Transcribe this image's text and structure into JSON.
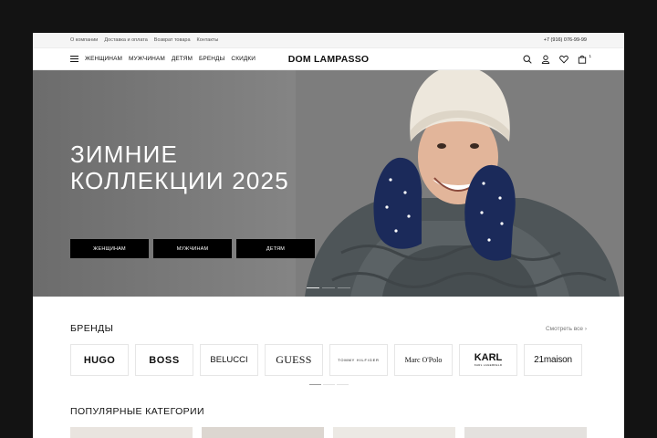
{
  "topbar": {
    "links": [
      "О компании",
      "Доставка и оплата",
      "Возврат товара",
      "Контакты"
    ],
    "phone": "+7 (916) 076-99-99"
  },
  "header": {
    "nav": [
      "ЖЕНЩИНАМ",
      "МУЖЧИНАМ",
      "ДЕТЯМ",
      "БРЕНДЫ",
      "СКИДКИ"
    ],
    "logo": "DOM LAMPASSO",
    "icons": [
      "search-icon",
      "user-icon",
      "heart-icon",
      "cart-icon"
    ],
    "cart_count": "1"
  },
  "hero": {
    "title_line1": "ЗИМНИЕ",
    "title_line2": "КОЛЛЕКЦИИ 2025",
    "buttons": [
      "ЖЕНЩИНАМ",
      "МУЖЧИНАМ",
      "ДЕТЯМ"
    ],
    "slides_total": 3,
    "active_slide": 1
  },
  "brands": {
    "title": "БРЕНДЫ",
    "see_all": "Смотреть все",
    "items": [
      "HUGO",
      "BOSS",
      "BELUCCI",
      "GUESS",
      "TOMMY HILFIGER",
      "Marc O'Polo",
      "KARL",
      "KARL LAGERFELD",
      "21maison"
    ]
  },
  "categories": {
    "title": "ПОПУЛЯРНЫЕ КАТЕГОРИИ"
  },
  "colors": {
    "accent": "#000000",
    "background": "#ffffff",
    "outer": "#131313"
  }
}
